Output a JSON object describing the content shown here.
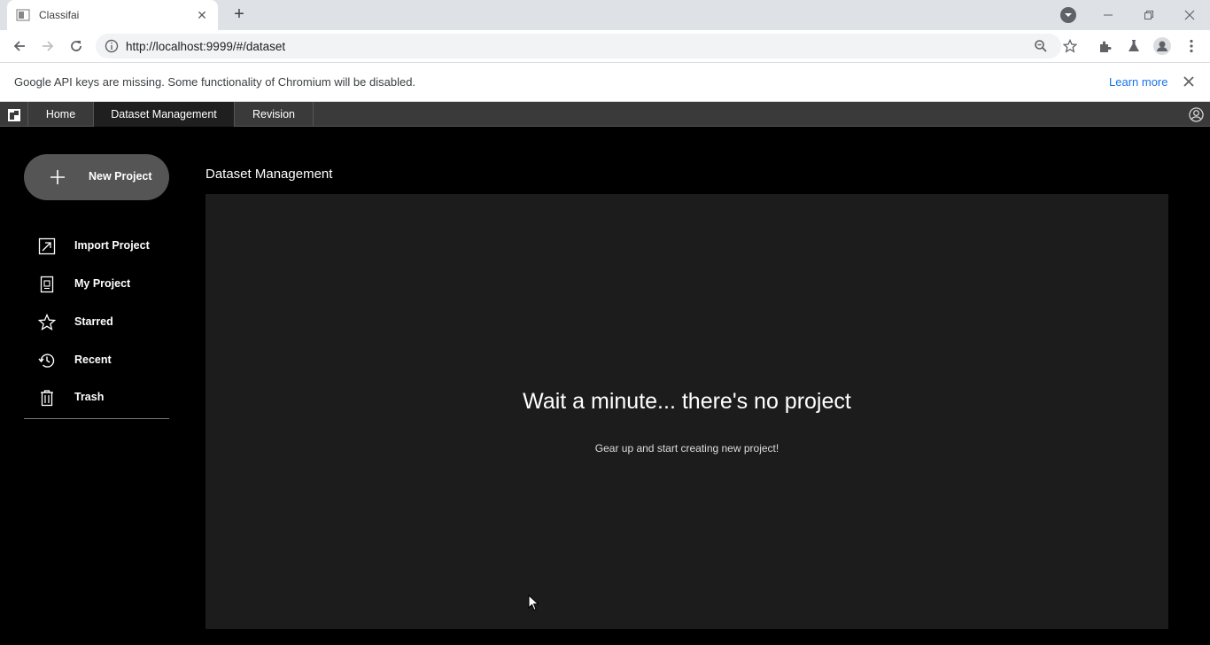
{
  "browser": {
    "tab_title": "Classifai",
    "url": "http://localhost:9999/#/dataset",
    "infobar_message": "Google API keys are missing. Some functionality of Chromium will be disabled.",
    "infobar_link": "Learn more"
  },
  "app": {
    "nav_tabs": [
      {
        "label": "Home",
        "active": false
      },
      {
        "label": "Dataset Management",
        "active": true
      },
      {
        "label": "Revision",
        "active": false
      }
    ]
  },
  "sidebar": {
    "new_project_label": "New Project",
    "items": [
      {
        "label": "Import Project",
        "icon": "import-icon"
      },
      {
        "label": "My Project",
        "icon": "project-icon"
      },
      {
        "label": "Starred",
        "icon": "star-icon"
      },
      {
        "label": "Recent",
        "icon": "history-icon"
      },
      {
        "label": "Trash",
        "icon": "trash-icon"
      }
    ]
  },
  "main": {
    "title": "Dataset Management",
    "empty_heading": "Wait a minute... there's no project",
    "empty_subtext": "Gear up and start creating new project!"
  }
}
